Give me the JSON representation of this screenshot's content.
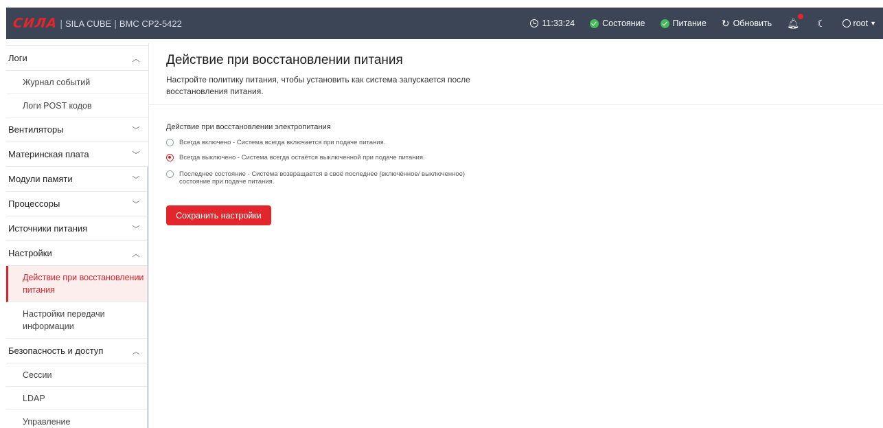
{
  "header": {
    "logo": "СИЛА",
    "product": "SILA CUBE",
    "device": "BMC CP2-5422",
    "time": "11:33:24",
    "status_label": "Состояние",
    "power_label": "Питание",
    "refresh_label": "Обновить",
    "user": "root",
    "colors": {
      "bar": "#3b4556",
      "brand": "#e3262c",
      "ok": "#46b95a"
    }
  },
  "sidebar": {
    "groups": [
      {
        "label": "Логи",
        "expanded": true,
        "items": [
          "Журнал событий",
          "Логи POST кодов"
        ]
      },
      {
        "label": "Вентиляторы",
        "expanded": false
      },
      {
        "label": "Материнская плата",
        "expanded": false
      },
      {
        "label": "Модули памяти",
        "expanded": false
      },
      {
        "label": "Процессоры",
        "expanded": false
      },
      {
        "label": "Источники питания",
        "expanded": false
      },
      {
        "label": "Настройки",
        "expanded": true,
        "items": [
          "Действие при восстановлении питания",
          "Настройки передачи информации"
        ],
        "active_item": "Действие при восстановлении питания"
      },
      {
        "label": "Безопасность и доступ",
        "expanded": true,
        "items": [
          "Сессии",
          "LDAP",
          "Управление"
        ]
      }
    ]
  },
  "main": {
    "title": "Действие при восстановлении питания",
    "description": "Настройте политику питания, чтобы установить как система запускается после восстановления питания.",
    "form_label": "Действие при восстановлении электропитания",
    "options": [
      {
        "label": "Всегда включено - Система всегда включается при подаче питания.",
        "checked": false
      },
      {
        "label": "Всегда выключено - Система всегда остаётся выключенной при подаче питания.",
        "checked": true
      },
      {
        "label": "Последнее состояние - Система возвращается в своё последнее (включённое/ выключенное) состояние при подаче питания.",
        "checked": false
      }
    ],
    "save_label": "Сохранить настройки"
  },
  "icons": {
    "clock": "clock-icon",
    "ok": "check-circle-icon",
    "refresh": "refresh-icon",
    "bell": "bell-icon",
    "moon": "moon-icon",
    "user": "user-circle-icon",
    "chevron_up": "chevron-up-icon",
    "chevron_down": "chevron-down-icon"
  }
}
